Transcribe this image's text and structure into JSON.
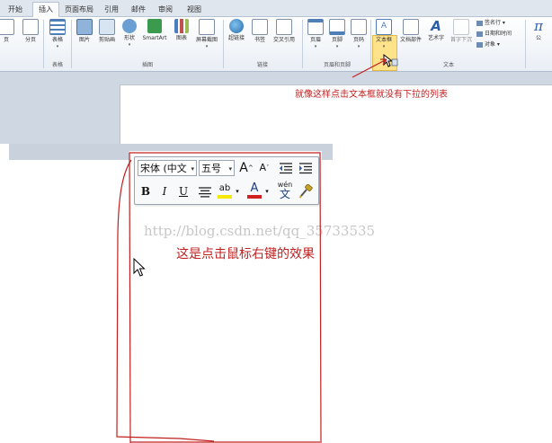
{
  "tabs": [
    "开始",
    "插入",
    "页面布局",
    "引用",
    "邮件",
    "审阅",
    "视图"
  ],
  "active_tab": "插入",
  "ribbon": {
    "buttons": {
      "page": "页",
      "pagebreak": "分页",
      "table": "表格",
      "picture": "图片",
      "clipart": "剪贴画",
      "shapes": "形状",
      "smartart": "SmartArt",
      "chart": "图表",
      "screenshot": "屏幕截图",
      "hyperlink": "超链接",
      "bookmark": "书签",
      "crossref": "交叉引用",
      "header": "页眉",
      "footer": "页脚",
      "pagenum": "页码",
      "textbox": "文本框",
      "quickparts": "文档部件",
      "wordart": "艺术字",
      "dropcap": "首字下沉",
      "signature": "签名行",
      "datetime": "日期和时间",
      "object": "对象",
      "equation": "公"
    },
    "groups": {
      "tables": "表格",
      "illustrations": "插图",
      "links": "链接",
      "header_footer": "页眉和页脚",
      "text": "文本"
    }
  },
  "annotations": {
    "note1": "就像这样点击文本框就没有下拉的列表",
    "note2": "这是点击鼠标右键的效果",
    "watermark": "http://blog.csdn.net/qq_35733535"
  },
  "minitoolbar": {
    "font": "宋体 (中文",
    "size": "五号",
    "grow_font": "A",
    "shrink_font": "A",
    "bold": "B",
    "italic": "I",
    "underline": "U",
    "highlight": "ab",
    "font_color": "A",
    "phonetic_top": "wén",
    "phonetic_bottom": "文"
  },
  "colors": {
    "annotation": "#c02020",
    "ribbon_bg": "#e9eef5",
    "highlight": "#ffe38a",
    "font_color_bar": "#d02020",
    "highlight_bar": "#f5e900"
  }
}
